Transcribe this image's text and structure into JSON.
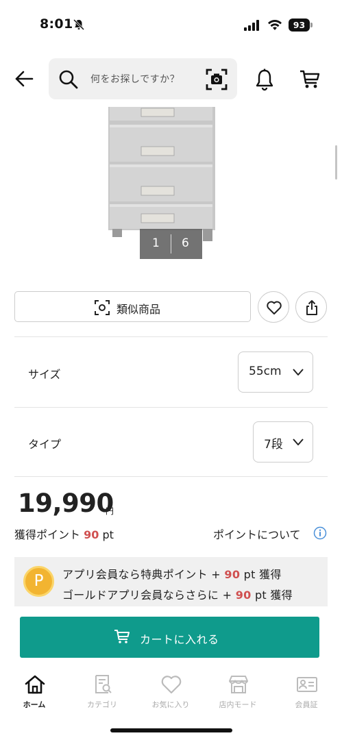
{
  "status_bar": {
    "time": "8:01",
    "battery": "93",
    "icons": [
      "bell-off-icon",
      "signal-icon",
      "wifi-icon",
      "battery-icon"
    ]
  },
  "header": {
    "search_placeholder": "何をお探しですか？",
    "icons": [
      "back-icon",
      "search-icon",
      "camera-search-icon",
      "bell-icon",
      "cart-icon"
    ]
  },
  "gallery": {
    "current": "1",
    "total": "6"
  },
  "similar": {
    "label": "類似商品"
  },
  "options": {
    "size": {
      "label": "サイズ",
      "value": "55cm"
    },
    "type": {
      "label": "タイプ",
      "value": "7段"
    }
  },
  "price": {
    "amount": "19,990",
    "currency": "円"
  },
  "points": {
    "label": "獲得ポイント",
    "value": "90",
    "unit": "pt",
    "about": "ポイントについて"
  },
  "member": {
    "badge": "P",
    "line1": {
      "prefix": "アプリ会員なら特典ポイント + ",
      "value": "90",
      "suffix": " pt 獲得"
    },
    "line2": {
      "prefix": "ゴールドアプリ会員ならさらに + ",
      "value": "90",
      "suffix": " pt 獲得"
    }
  },
  "cart_button": {
    "label": "カートに入れる"
  },
  "bottom_nav": [
    {
      "label": "ホーム",
      "icon": "home-icon",
      "active": true
    },
    {
      "label": "カテゴリ",
      "icon": "category-icon",
      "active": false
    },
    {
      "label": "お気に入り",
      "icon": "heart-icon",
      "active": false
    },
    {
      "label": "店内モード",
      "icon": "store-icon",
      "active": false
    },
    {
      "label": "会員証",
      "icon": "member-card-icon",
      "active": false
    }
  ],
  "colors": {
    "accent": "#0f9b8c",
    "point_red": "#d05050",
    "point_badge": "#f2b431",
    "info_blue": "#4a90d9"
  }
}
